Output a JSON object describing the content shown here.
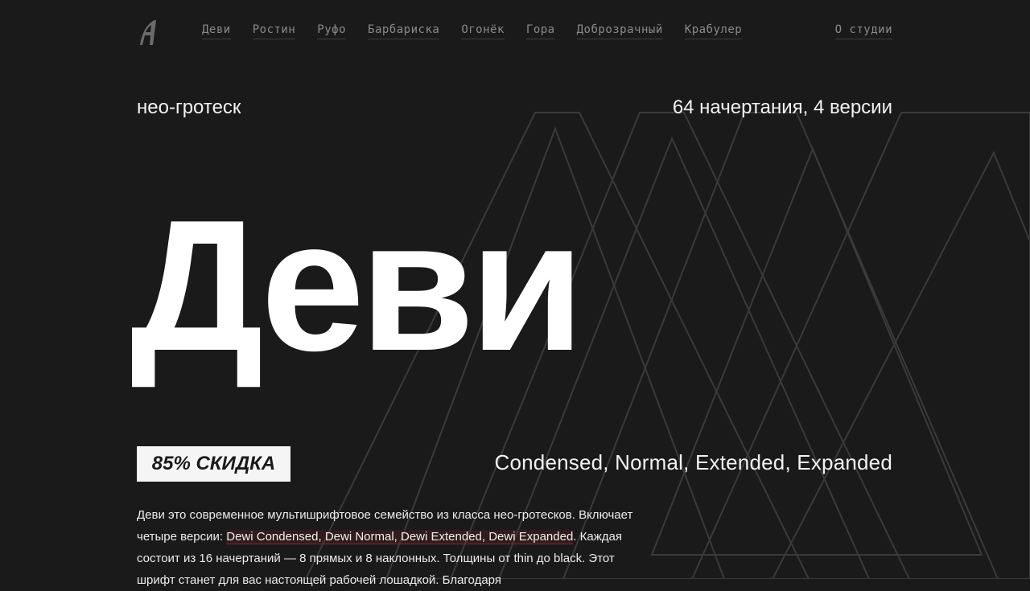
{
  "nav": {
    "items": [
      "Деви",
      "Ростин",
      "Руфо",
      "Барбариска",
      "Огонёк",
      "Гора",
      "Доброзрачный",
      "Крабулер"
    ],
    "studio": "О студии"
  },
  "hero": {
    "class_label": "нео-гротеск",
    "styles_count": "64 начертания, 4 версии",
    "title": "Деви",
    "discount": "85% СКИДКА",
    "versions": "Condensed, Normal, Extended, Expanded"
  },
  "description": {
    "lead": "Деви это современное мультишрифтовое семейство из класса нео-гротесков. Включает четыре версии: ",
    "link": "Dewi Condensed, Dewi Normal, Dewi Extended, Dewi Expanded",
    "tail": ". Каждая состоит из 16 начертаний — 8 прямых и 8 наклонных. Толщины от thin до black. Этот шрифт станет для вас настоящей рабочей лошадкой. Благодаря"
  },
  "colors": {
    "background": "#1a1a1a",
    "text": "#ffffff",
    "nav_text": "#8a8a8a",
    "link_underline": "#7a2a33"
  }
}
